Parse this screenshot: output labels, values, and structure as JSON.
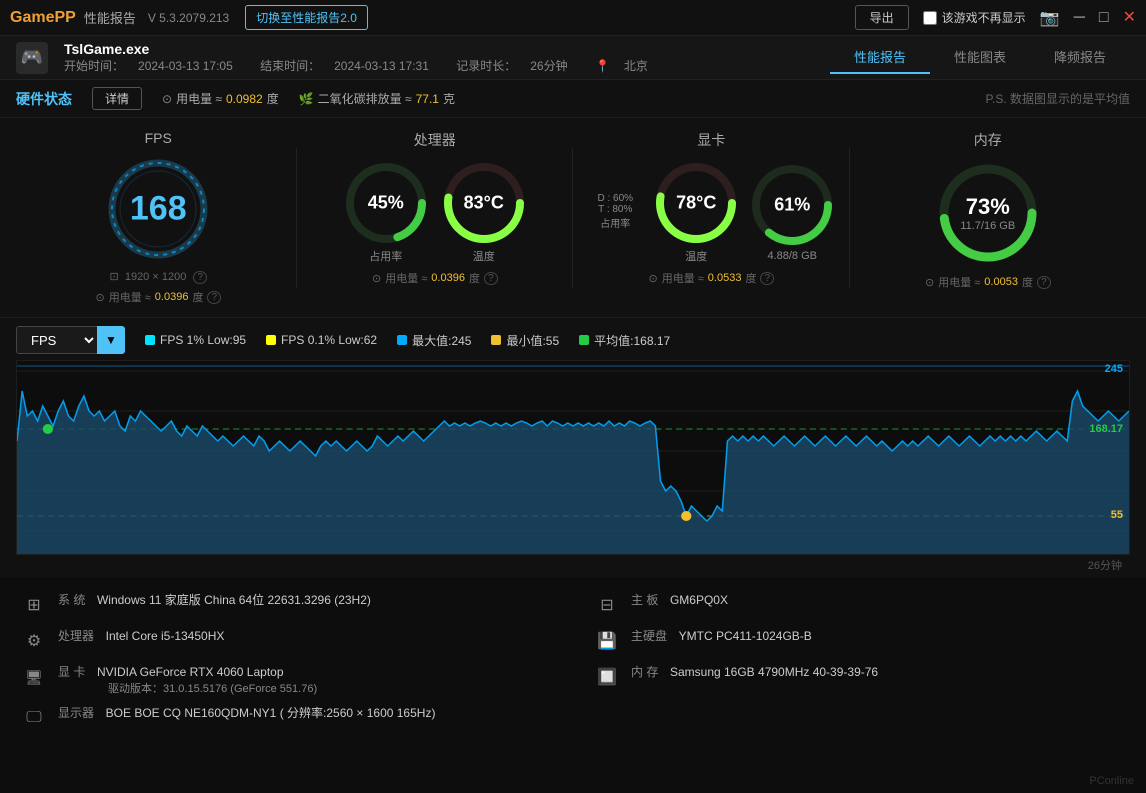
{
  "titlebar": {
    "logo_game": "Game",
    "logo_pp": "PP",
    "title": "性能报告",
    "version": "V 5.3.2079.213",
    "switch_btn": "切换至性能报告2.0",
    "export_btn": "导出",
    "no_show": "该游戏不再显示",
    "minimize_icon": "─",
    "maximize_icon": "□",
    "close_icon": "✕"
  },
  "gameinfo": {
    "game_name": "TslGame.exe",
    "start_label": "开始时间：",
    "start_time": "2024-03-13 17:05",
    "end_label": "结束时间：",
    "end_time": "2024-03-13 17:31",
    "duration_label": "记录时长：",
    "duration": "26分钟",
    "location_icon": "📍",
    "location": "北京"
  },
  "nav_tabs": [
    {
      "id": "perf-report",
      "label": "性能报告",
      "active": true
    },
    {
      "id": "perf-chart",
      "label": "性能图表",
      "active": false
    },
    {
      "id": "reduce-report",
      "label": "降频报告",
      "active": false
    }
  ],
  "hw_bar": {
    "title": "硬件状态",
    "detail_btn": "详情",
    "power_icon": "⊙",
    "power_label": "用电量 ≈",
    "power_val": "0.0982",
    "power_unit": "度",
    "co2_icon": "🌿",
    "co2_label": "二氧化碳排放量 ≈",
    "co2_val": "77.1",
    "co2_unit": "克",
    "ps_note": "P.S. 数据图显示的是平均值"
  },
  "metrics": {
    "fps": {
      "label": "FPS",
      "value": "168",
      "display_info": "1920 × 1200",
      "display_icon": "⊡",
      "help_icon": "?",
      "power_label": "用电量 ≈",
      "power_val": "0.0396",
      "power_unit": "度",
      "power_help": "?"
    },
    "cpu": {
      "label": "处理器",
      "usage_val": "45%",
      "usage_sub": "占用率",
      "temp_val": "83°C",
      "temp_sub": "温度",
      "power_label": "用电量 ≈",
      "power_val": "0.0396",
      "power_unit": "度",
      "power_help": "?"
    },
    "gpu": {
      "label": "显卡",
      "d_val": "D : 60%",
      "t_val": "T : 80%",
      "usage_sub": "占用率",
      "temp_val": "78°C",
      "temp_sub": "温度",
      "vram_val": "61%",
      "vram_sub": "4.88/8 GB",
      "power_label": "用电量 ≈",
      "power_val": "0.0533",
      "power_unit": "度",
      "power_help": "?"
    },
    "ram": {
      "label": "内存",
      "val": "73%",
      "sub": "11.7/16 GB",
      "power_label": "用电量 ≈",
      "power_val": "0.0053",
      "power_unit": "度",
      "power_help": "?"
    }
  },
  "chart": {
    "select_label": "FPS",
    "dropdown_icon": "▼",
    "legend": [
      {
        "id": "fps1pct",
        "color": "#00e5ff",
        "label": "FPS 1% Low:95"
      },
      {
        "id": "fps01pct",
        "color": "#ffff00",
        "label": "FPS 0.1% Low:62"
      },
      {
        "id": "max",
        "color": "#00aaff",
        "label": "最大值:245"
      },
      {
        "id": "min",
        "color": "#f0c030",
        "label": "最小值:55"
      },
      {
        "id": "avg",
        "color": "#22cc44",
        "label": "平均值:168.17"
      }
    ],
    "max_label": "245",
    "avg_label": "168.17",
    "min_label": "55",
    "time_label": "26分钟",
    "max_color": "#00aaff",
    "avg_color": "#22cc44",
    "min_color": "#f0c030"
  },
  "sysinfo": {
    "left": [
      {
        "icon": "⊞",
        "key": "系 统",
        "val": "Windows 11 家庭版 China 64位 22631.3296 (23H2)",
        "sub": ""
      },
      {
        "icon": "⚙",
        "key": "处理器",
        "val": "Intel Core i5-13450HX",
        "sub": ""
      },
      {
        "icon": "🖥",
        "key": "显 卡",
        "val": "NVIDIA GeForce RTX 4060 Laptop",
        "sub": "驱动版本：31.0.15.5176 (GeForce 551.76)"
      },
      {
        "icon": "🖵",
        "key": "显示器",
        "val": "BOE BOE CQ NE160QDM-NY1 ( 分辨率:2560 × 1600 165Hz)",
        "sub": ""
      }
    ],
    "right": [
      {
        "icon": "⊟",
        "key": "主 板",
        "val": "GM6PQ0X",
        "sub": ""
      },
      {
        "icon": "💾",
        "key": "主硬盘",
        "val": "YMTC PC411-1024GB-B",
        "sub": ""
      },
      {
        "icon": "🔲",
        "key": "内 存",
        "val": "Samsung 16GB 4790MHz 40-39-39-76",
        "sub": ""
      }
    ]
  },
  "watermark": "PConline"
}
